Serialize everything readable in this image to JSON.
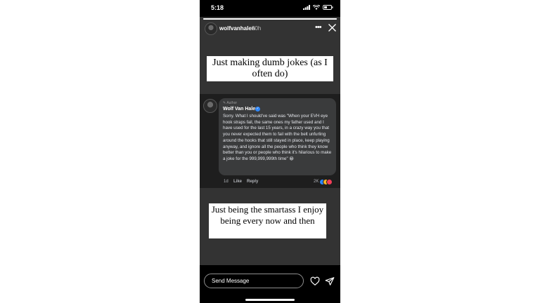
{
  "status_bar": {
    "time": "5:18"
  },
  "story": {
    "username": "wolfvanhalen",
    "time_ago": "20h",
    "progress": 1.0,
    "caption_top": "Just making dumb jokes (as I often do)",
    "caption_bottom": "Just being the smartass I enjoy being every now and then"
  },
  "comment": {
    "badge": "Author",
    "name": "Wolf Van Halen",
    "text": "Sorry. What I should've said was \"When your EVH eye hook straps fail, the same ones my father used and I have used for the last 15 years, in a crazy way you that you never expected them to fail with the belt unfurling around the hooks that still stayed in place, keep playing anyway, and ignore all the people who think they know better than you or people who think it's hilarious to make a joke for the 999,999,999th time\" 😀",
    "age": "1d",
    "like_label": "Like",
    "reply_label": "Reply",
    "reaction_count": "2K",
    "reactions": [
      "like-icon",
      "haha-icon",
      "love-icon"
    ]
  },
  "bottom_bar": {
    "message_placeholder": "Send Message"
  },
  "colors": {
    "story_bg": "#333333",
    "comment_bg": "#1e1e1e",
    "bubble_bg": "#3a3b3c",
    "verified": "#2d88ff"
  }
}
